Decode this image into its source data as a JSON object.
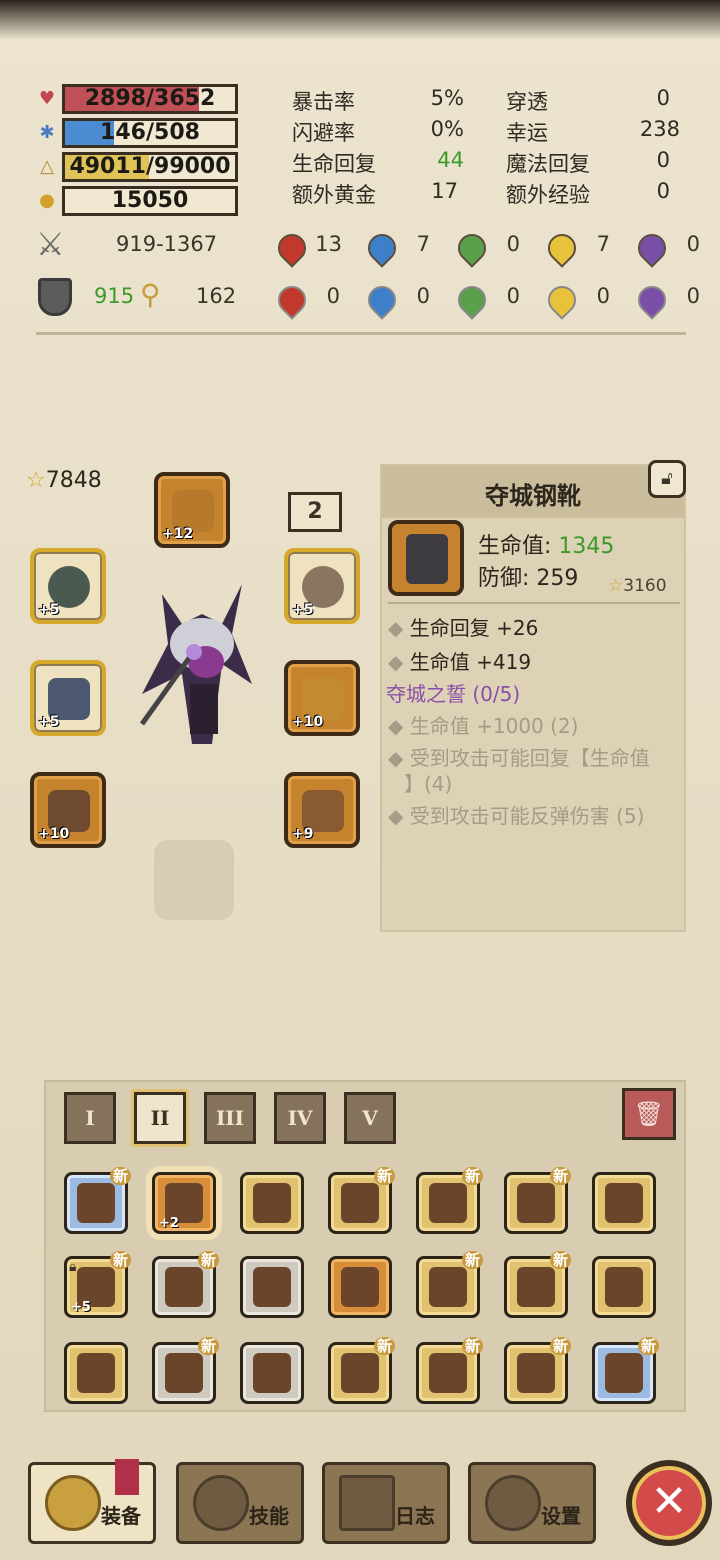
{
  "colors": {
    "hp": "#bf5057",
    "mp": "#4a8bd2",
    "xp": "#e0c45a",
    "green_value": "#3d9a2a",
    "set_purple": "#8a4fa8"
  },
  "vitals": {
    "hp": {
      "text": "2898/3652",
      "fraction": 0.79
    },
    "mp": {
      "text": "146/508",
      "fraction": 0.29
    },
    "xp": {
      "text": "49011/99000",
      "fraction": 0.495
    },
    "gold": {
      "text": "15050"
    }
  },
  "stats": [
    {
      "label": "暴击率",
      "value": "5%"
    },
    {
      "label": "穿透",
      "value": "0"
    },
    {
      "label": "闪避率",
      "value": "0%"
    },
    {
      "label": "幸运",
      "value": "238"
    },
    {
      "label": "生命回复",
      "value": "44"
    },
    {
      "label": "魔法回复",
      "value": "0"
    },
    {
      "label": "额外黄金",
      "value": "17"
    },
    {
      "label": "额外经验",
      "value": "0"
    }
  ],
  "attack": {
    "range": "919-1367",
    "elements": [
      "13",
      "7",
      "0",
      "7",
      "0"
    ]
  },
  "defense": {
    "armor": "915",
    "magic": "162",
    "elements": [
      "0",
      "0",
      "0",
      "0",
      "0"
    ]
  },
  "character": {
    "power": "7848",
    "badge": "2"
  },
  "equipped": [
    {
      "name": "helmet",
      "plus": "+12"
    },
    {
      "name": "amulet",
      "plus": "+5"
    },
    {
      "name": "ring",
      "plus": "+5"
    },
    {
      "name": "weapon",
      "plus": "+5"
    },
    {
      "name": "offhand",
      "plus": "+10"
    },
    {
      "name": "armor",
      "plus": "+10"
    },
    {
      "name": "belt",
      "plus": "+9"
    }
  ],
  "item": {
    "name": "夺城钢靴",
    "hp_label": "生命值:",
    "hp_value": "1345",
    "def": "防御: 259",
    "power": "3160",
    "bonuses": [
      "生命回复 +26",
      "生命值 +419"
    ],
    "set_name": "夺城之誓 (0/5)",
    "set_bonuses": [
      "生命值 +1000 (2)",
      "受到攻击可能回复【生命值",
      "】(4)",
      "受到攻击可能反弹伤害 (5)"
    ]
  },
  "tabs": [
    "I",
    "II",
    "III",
    "IV",
    "V"
  ],
  "inventory": {
    "new_label": "新",
    "rows": [
      [
        {
          "tier": "blue",
          "new": true,
          "plus": ""
        },
        {
          "tier": "orange",
          "new": false,
          "plus": "+2",
          "selected": true
        },
        {
          "tier": "gold",
          "new": false,
          "plus": ""
        },
        {
          "tier": "gold",
          "new": true,
          "plus": ""
        },
        {
          "tier": "gold",
          "new": true,
          "plus": ""
        },
        {
          "tier": "gold",
          "new": true,
          "plus": ""
        },
        {
          "tier": "gold",
          "new": false,
          "plus": ""
        }
      ],
      [
        {
          "tier": "gold",
          "new": true,
          "plus": "+5",
          "locked": true
        },
        {
          "tier": "grey",
          "new": true,
          "plus": ""
        },
        {
          "tier": "grey",
          "new": false,
          "plus": ""
        },
        {
          "tier": "orange",
          "new": false,
          "plus": ""
        },
        {
          "tier": "gold",
          "new": true,
          "plus": ""
        },
        {
          "tier": "gold",
          "new": true,
          "plus": ""
        },
        {
          "tier": "gold",
          "new": false,
          "plus": ""
        }
      ],
      [
        {
          "tier": "gold",
          "new": false,
          "plus": ""
        },
        {
          "tier": "grey",
          "new": true,
          "plus": ""
        },
        {
          "tier": "grey",
          "new": false,
          "plus": ""
        },
        {
          "tier": "gold",
          "new": true,
          "plus": ""
        },
        {
          "tier": "gold",
          "new": true,
          "plus": ""
        },
        {
          "tier": "gold",
          "new": true,
          "plus": ""
        },
        {
          "tier": "blue",
          "new": true,
          "plus": ""
        }
      ]
    ]
  },
  "nav": [
    "装备",
    "技能",
    "日志",
    "设置"
  ]
}
